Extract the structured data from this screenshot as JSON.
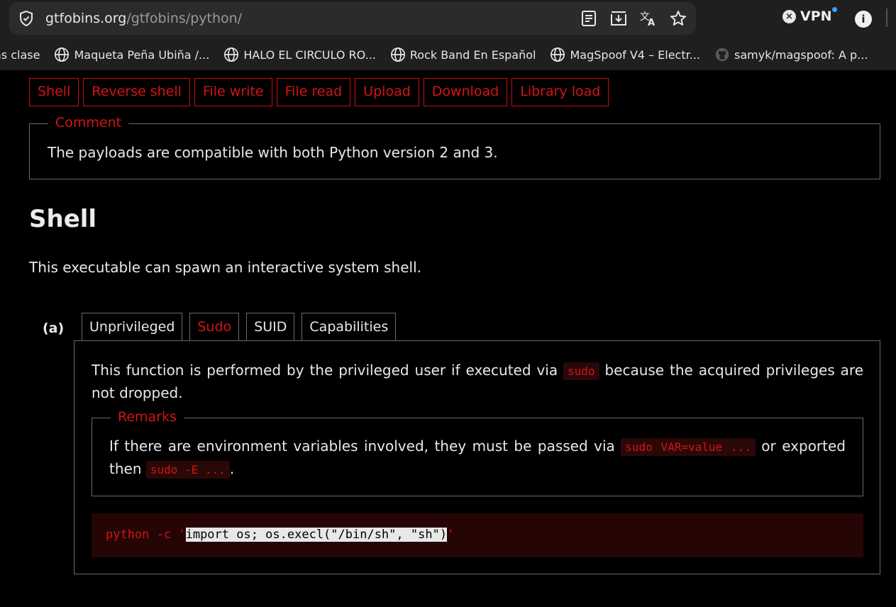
{
  "browser": {
    "url_host": "gtfobins.org",
    "url_path": "/gtfobins/python/",
    "vpn_label": "VPN",
    "info_label": "i",
    "bookmarks": [
      {
        "label": "as clase",
        "icon": "none"
      },
      {
        "label": "Maqueta Peña Ubiña /...",
        "icon": "globe-icon"
      },
      {
        "label": "HALO EL CIRCULO RO...",
        "icon": "globe-icon"
      },
      {
        "label": "Rock Band En Español",
        "icon": "globe-icon"
      },
      {
        "label": "MagSpoof V4 – Electr...",
        "icon": "globe-icon"
      },
      {
        "label": "samyk/magspoof: A p...",
        "icon": "github-icon"
      }
    ]
  },
  "function_tabs": [
    "Shell",
    "Reverse shell",
    "File write",
    "File read",
    "Upload",
    "Download",
    "Library load"
  ],
  "comment": {
    "legend": "Comment",
    "text": "The payloads are compatible with both Python version 2 and 3."
  },
  "shell": {
    "title": "Shell",
    "description": "This executable can spawn an interactive system shell."
  },
  "example": {
    "label": "(a)",
    "tabs": [
      "Unprivileged",
      "Sudo",
      "SUID",
      "Capabilities"
    ],
    "active_tab": "Sudo",
    "text_before": "This function is performed by the privileged user if executed via ",
    "text_code": "sudo",
    "text_after": " because the acquired privileges are not dropped.",
    "remarks": {
      "legend": "Remarks",
      "text_1": "If there are environment variables involved, they must be passed via ",
      "code_1": "sudo VAR=value ...",
      "text_2": " or exported then ",
      "code_2": "sudo -E ...",
      "text_3": "."
    },
    "code": {
      "prefix": "python -c '",
      "selected": "import os; os.execl(\"/bin/sh\", \"sh\")",
      "suffix": "'"
    }
  },
  "colors": {
    "accent_red": "#d41414",
    "background": "#000000",
    "chrome": "#1f1f1f"
  }
}
